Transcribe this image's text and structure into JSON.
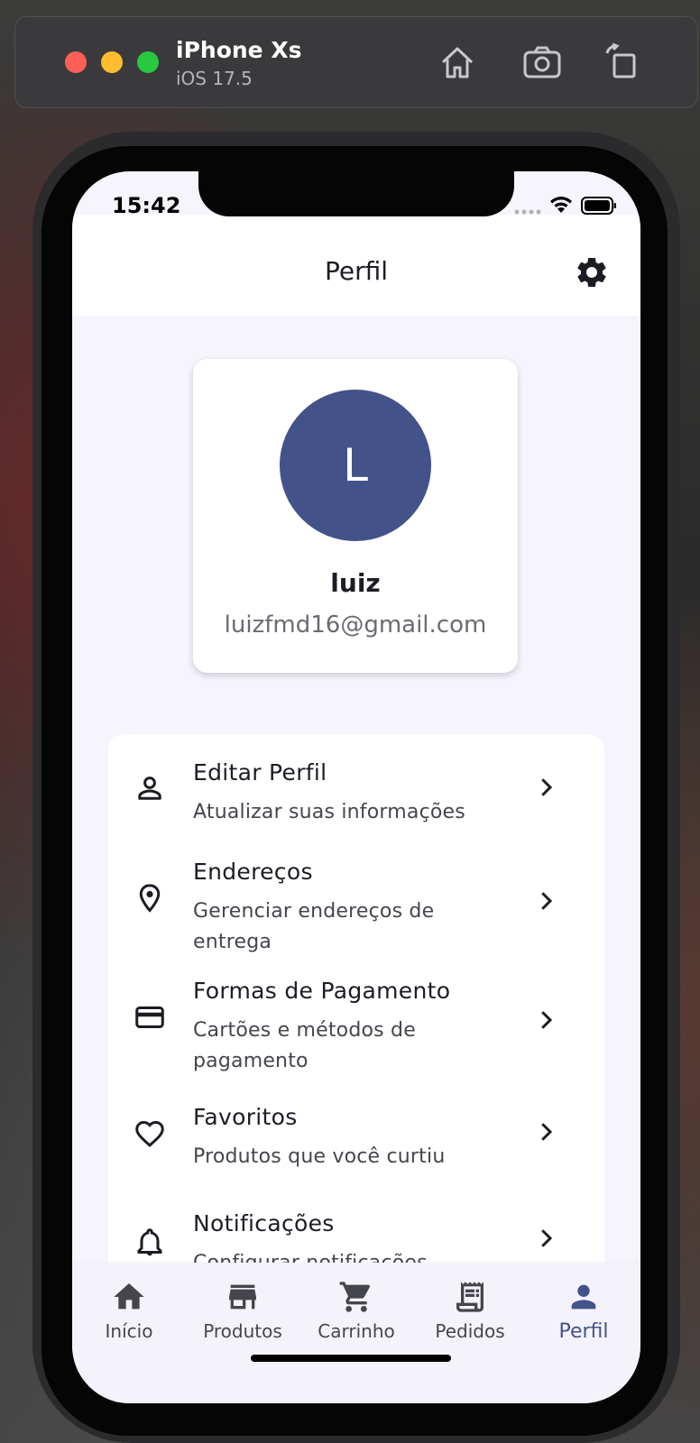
{
  "simulator": {
    "device_name": "iPhone Xs",
    "os_version": "iOS 17.5"
  },
  "status_bar": {
    "time": "15:42"
  },
  "app_bar": {
    "title": "Perfil"
  },
  "profile": {
    "avatar_initial": "L",
    "avatar_color": "#44528a",
    "name": "luiz",
    "email": "luizfmd16@gmail.com"
  },
  "menu": {
    "items": [
      {
        "icon": "person-icon",
        "title": "Editar Perfil",
        "subtitle": "Atualizar suas informações"
      },
      {
        "icon": "location-pin-icon",
        "title": "Endereços",
        "subtitle": "Gerenciar endereços de entrega"
      },
      {
        "icon": "credit-card-icon",
        "title": "Formas de Pagamento",
        "subtitle": "Cartões e métodos de pagamento"
      },
      {
        "icon": "heart-icon",
        "title": "Favoritos",
        "subtitle": "Produtos que você curtiu"
      },
      {
        "icon": "bell-icon",
        "title": "Notificações",
        "subtitle": "Configurar notificações"
      }
    ]
  },
  "bottom_nav": {
    "items": [
      {
        "icon": "home-icon",
        "label": "Início"
      },
      {
        "icon": "store-icon",
        "label": "Produtos"
      },
      {
        "icon": "cart-icon",
        "label": "Carrinho"
      },
      {
        "icon": "receipt-icon",
        "label": "Pedidos"
      },
      {
        "icon": "person-icon",
        "label": "Perfil"
      }
    ],
    "active": "Perfil",
    "active_color": "#44528a"
  }
}
